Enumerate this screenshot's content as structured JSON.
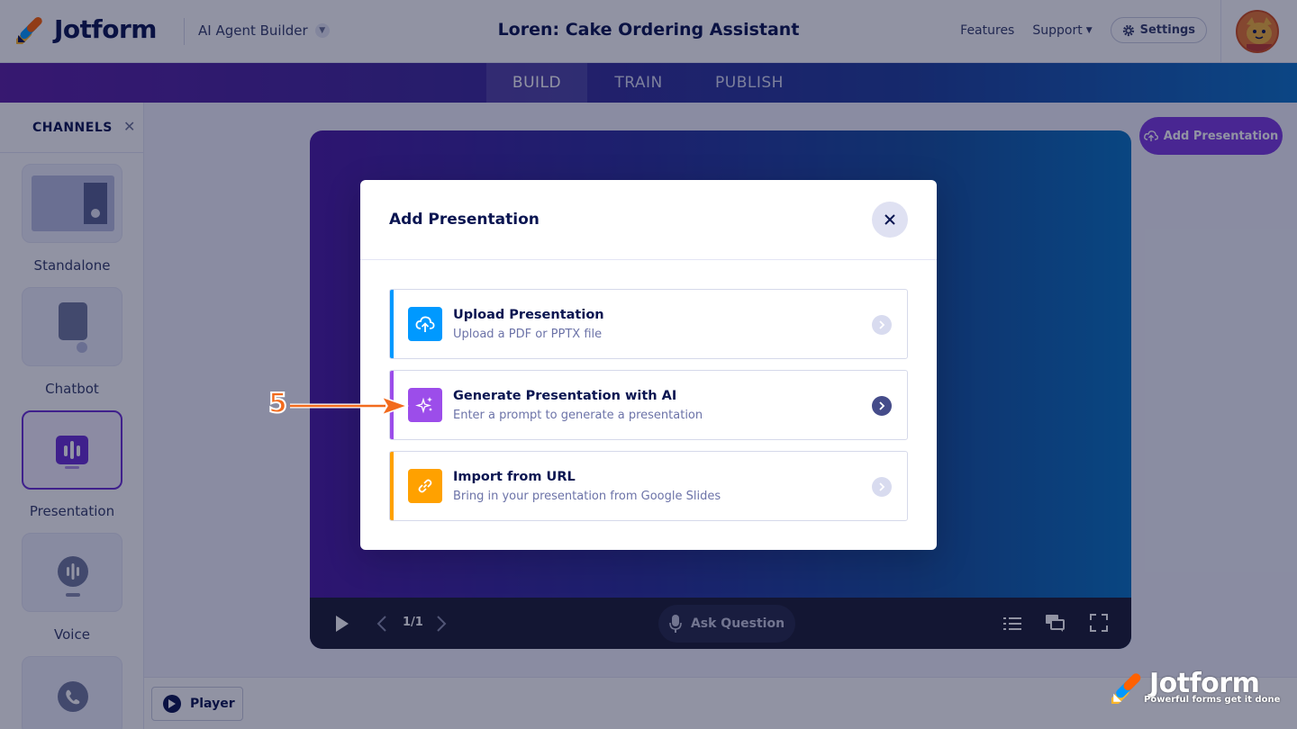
{
  "header": {
    "logo_text": "Jotform",
    "product_switcher": "AI Agent Builder",
    "app_title": "Loren: Cake Ordering Assistant",
    "links": [
      "Features",
      "Support"
    ],
    "settings_label": "Settings"
  },
  "tabs": [
    {
      "label": "BUILD",
      "active": true
    },
    {
      "label": "TRAIN",
      "active": false
    },
    {
      "label": "PUBLISH",
      "active": false
    }
  ],
  "sidebar": {
    "title": "CHANNELS",
    "items": [
      {
        "label": "Standalone",
        "icon": "standalone-icon",
        "active": false
      },
      {
        "label": "Chatbot",
        "icon": "chatbot-icon",
        "active": false
      },
      {
        "label": "Presentation",
        "icon": "presentation-icon",
        "active": true
      },
      {
        "label": "Voice",
        "icon": "voice-icon",
        "active": false
      },
      {
        "label": "",
        "icon": "phone-icon",
        "active": false
      }
    ]
  },
  "main": {
    "add_presentation_label": "Add Presentation",
    "player": {
      "page_indicator": "1/1",
      "ask_question_label": "Ask Question"
    },
    "player_button_label": "Player"
  },
  "modal": {
    "title": "Add Presentation",
    "options": [
      {
        "title": "Upload Presentation",
        "subtitle": "Upload a PDF or PPTX file",
        "icon": "cloud-upload-icon",
        "accent": "#0099ff"
      },
      {
        "title": "Generate Presentation with AI",
        "subtitle": "Enter a prompt to generate a presentation",
        "icon": "sparkles-icon",
        "accent": "#9c4dea"
      },
      {
        "title": "Import from URL",
        "subtitle": "Bring in your presentation from Google Slides",
        "icon": "link-icon",
        "accent": "#ffa100"
      }
    ]
  },
  "annotation": {
    "step": "5"
  },
  "watermark": {
    "text": "Jotform",
    "tagline": "Powerful forms get it done"
  },
  "colors": {
    "brand_purple": "#7d3ae0",
    "navy": "#0a1551",
    "upload_blue": "#0099ff",
    "ai_purple": "#9c4dea",
    "url_orange": "#ffa100",
    "annotation_orange": "#f26b1d"
  }
}
